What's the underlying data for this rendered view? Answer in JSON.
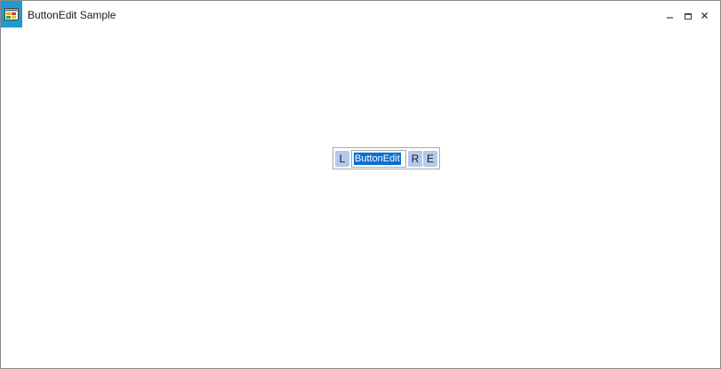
{
  "window": {
    "title": "ButtonEdit Sample",
    "icon": "app-form-icon",
    "controls": {
      "minimize": "minimize-icon",
      "maximize": "maximize-icon",
      "close": "close-icon"
    }
  },
  "button_edit": {
    "left_button": "L",
    "text_value": "ButtonEdit",
    "text_selected": true,
    "right_button": "R",
    "extra_button": "E"
  },
  "colors": {
    "icon_bg": "#1e9ad6",
    "button_bg": "#b4c8ec",
    "selection_bg": "#0a6fd0"
  }
}
